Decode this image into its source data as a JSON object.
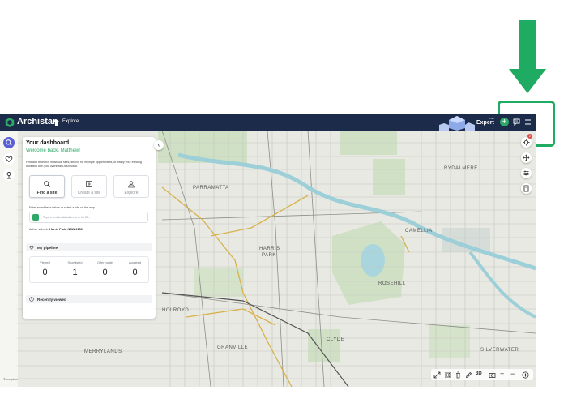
{
  "annotation": {
    "arrow_color": "#1fab62",
    "box_color": "#1fab62"
  },
  "header": {
    "app_name": "Archistar",
    "explore_label": "Explore",
    "plan_label_small": "Plan",
    "plan_label": "Expert",
    "plus_icon": "plus-icon",
    "chat_icon": "chat-icon",
    "menu_icon": "menu-icon",
    "bg_color": "#1c2b49"
  },
  "left_strip": {
    "icons": [
      "search-icon",
      "heart-icon",
      "pin-icon"
    ]
  },
  "dashboard": {
    "title": "Your dashboard",
    "welcome": "Welcome back, Matthew!",
    "description": "Find and research individual sites, search for multiple opportunities, or easily your existing workflow with your Archistar Dashboard.",
    "cards": [
      {
        "label": "Find a site",
        "icon": "find-site-icon"
      },
      {
        "label": "Create a site",
        "icon": "create-site-icon"
      },
      {
        "label": "Explore",
        "icon": "explore-icon"
      }
    ],
    "address_help": "Enter an address below or select a site on the map.",
    "address_placeholder": "Type a residential address or lot ID...",
    "active_suburb_label": "Active suburb:",
    "active_suburb_value": "Harris Park, NSW 2150",
    "pipeline_title": "My pipeline",
    "pipeline": [
      {
        "label": "Viewed",
        "value": "0"
      },
      {
        "label": "Shortlisted",
        "value": "1"
      },
      {
        "label": "Offer made",
        "value": "0"
      },
      {
        "label": "Acquired",
        "value": "0"
      }
    ],
    "recent_title": "Recently viewed",
    "recent_empty": "-"
  },
  "map": {
    "labels": [
      {
        "text": "PARRAMATTA",
        "cls": "lbl-parramatta"
      },
      {
        "text": "HARRIS",
        "cls": "lbl-harris"
      },
      {
        "text": "PARK",
        "cls": "lbl-park"
      },
      {
        "text": "ROSEHILL",
        "cls": "lbl-rosehill"
      },
      {
        "text": "RYDALMERE",
        "cls": "lbl-rydalmere"
      },
      {
        "text": "CAMELLIA",
        "cls": "lbl-camellia"
      },
      {
        "text": "HOLROYD",
        "cls": "lbl-holroyd"
      },
      {
        "text": "CLYDE",
        "cls": "lbl-clyde"
      },
      {
        "text": "MERRYLANDS",
        "cls": "lbl-merrylands"
      },
      {
        "text": "GRANVILLE",
        "cls": "lbl-granville"
      },
      {
        "text": "SILVERWATER",
        "cls": "lbl-silverwater"
      }
    ],
    "attribution": "© mapbox",
    "layers_badge": "2"
  },
  "map_tools": {
    "right_icons": [
      "layers-icon",
      "move-icon",
      "filter-icon",
      "book-icon"
    ],
    "bottom_icons": [
      "expand-icon",
      "measure-icon",
      "trash-icon",
      "pencil-icon",
      "camera-icon",
      "compass-icon"
    ],
    "view_3d": "3D",
    "zoom_in": "+",
    "zoom_out": "−"
  }
}
